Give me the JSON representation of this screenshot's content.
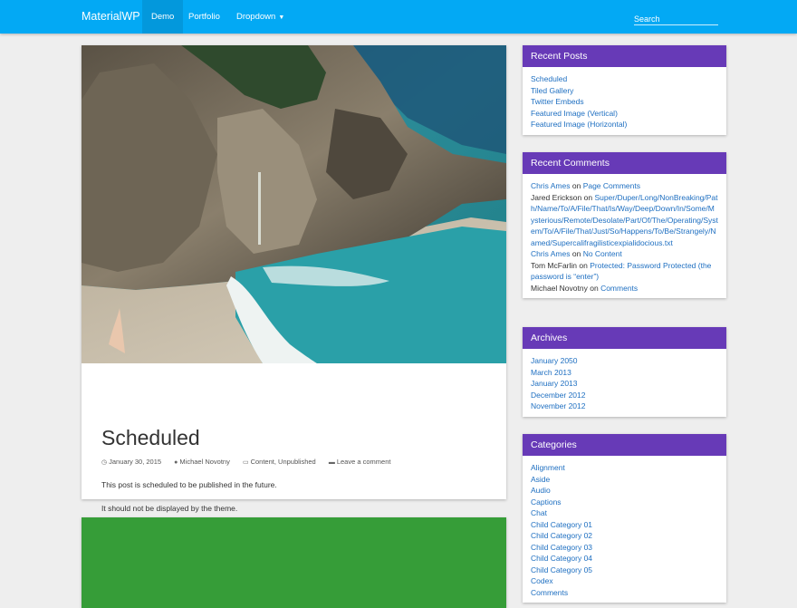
{
  "navbar": {
    "brand": "MaterialWP",
    "items": [
      {
        "label": "Demo",
        "active": true
      },
      {
        "label": "Portfolio"
      },
      {
        "label": "Dropdown",
        "has_caret": true
      }
    ],
    "search_placeholder": "Search",
    "color": "#03a9f4"
  },
  "post": {
    "title": "Scheduled",
    "meta": {
      "date": "January 30, 2015",
      "author": "Michael Novotny",
      "categories": [
        "Content",
        "Unpublished"
      ],
      "comment_link": "Leave a comment"
    },
    "body": [
      "This post is scheduled to be published in the future.",
      "It should not be displayed by the theme."
    ]
  },
  "next_post": {
    "color": "#369d38"
  },
  "sidebar": {
    "accent": "#673ab7",
    "recent_posts": {
      "title": "Recent Posts",
      "items": [
        "Scheduled",
        "Tiled Gallery",
        "Twitter Embeds",
        "Featured Image (Vertical)",
        "Featured Image (Horizontal)"
      ]
    },
    "recent_comments": {
      "title": "Recent Comments",
      "on": "on",
      "items": [
        {
          "author": "Chris Ames",
          "author_linked": true,
          "post": "Page Comments"
        },
        {
          "author": "Jared Erickson",
          "author_linked": false,
          "post": "Super/Duper/Long/NonBreaking/Path/Name/To/A/File/That/Is/Way/Deep/Down/In/Some/Mysterious/Remote/Desolate/Part/Of/The/Operating/System/To/A/File/That/Just/So/Happens/To/Be/Strangely/Named/Supercalifragilisticexpialidocious.txt"
        },
        {
          "author": "Chris Ames",
          "author_linked": true,
          "post": "No Content"
        },
        {
          "author": "Tom McFarlin",
          "author_linked": false,
          "post": "Protected: Password Protected (the password is “enter”)"
        },
        {
          "author": "Michael Novotny",
          "author_linked": false,
          "post": "Comments"
        }
      ]
    },
    "archives": {
      "title": "Archives",
      "items": [
        "January 2050",
        "March 2013",
        "January 2013",
        "December 2012",
        "November 2012"
      ]
    },
    "categories": {
      "title": "Categories",
      "items": [
        "Alignment",
        "Aside",
        "Audio",
        "Captions",
        "Chat",
        "Child Category 01",
        "Child Category 02",
        "Child Category 03",
        "Child Category 04",
        "Child Category 05",
        "Codex",
        "Comments"
      ]
    }
  }
}
